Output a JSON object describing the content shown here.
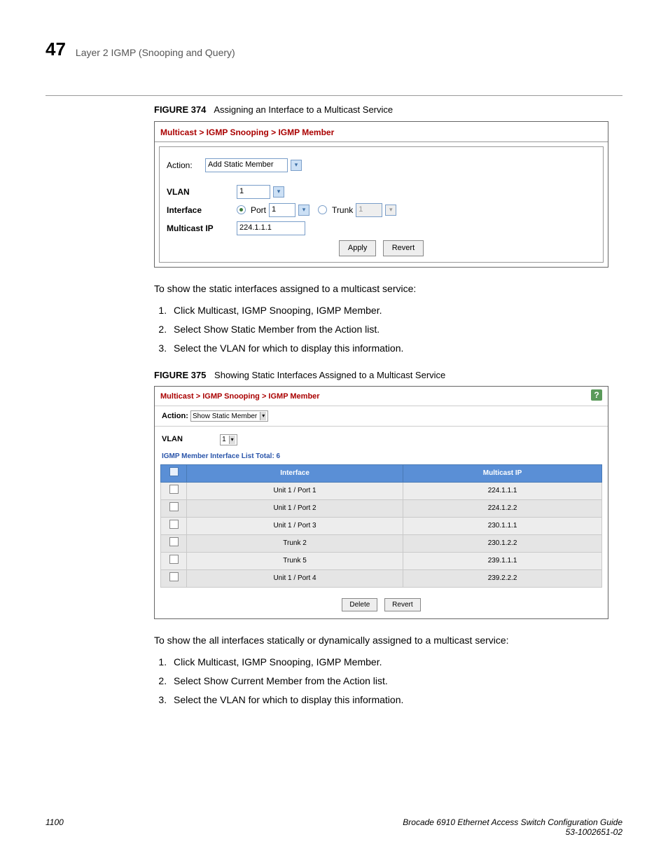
{
  "header": {
    "chapter_number": "47",
    "chapter_title": "Layer 2 IGMP (Snooping and Query)"
  },
  "fig374": {
    "num": "FIGURE 374",
    "caption": "Assigning an Interface to a Multicast Service",
    "breadcrumb": "Multicast > IGMP Snooping > IGMP Member",
    "action_label": "Action:",
    "action_value": "Add Static Member",
    "vlan_label": "VLAN",
    "vlan_value": "1",
    "iface_label": "Interface",
    "port_label": "Port",
    "port_value": "1",
    "trunk_label": "Trunk",
    "trunk_value": "1",
    "mcast_label": "Multicast IP",
    "mcast_value": "224.1.1.1",
    "apply": "Apply",
    "revert": "Revert"
  },
  "section1": {
    "intro": "To show the static interfaces assigned to a multicast service:",
    "steps": [
      "Click Multicast, IGMP Snooping, IGMP Member.",
      "Select Show Static Member from the Action list.",
      "Select the VLAN for which to display this information."
    ]
  },
  "fig375": {
    "num": "FIGURE 375",
    "caption": "Showing Static Interfaces Assigned to a Multicast Service",
    "breadcrumb": "Multicast > IGMP Snooping > IGMP Member",
    "action_label": "Action:",
    "action_value": "Show Static Member",
    "vlan_label": "VLAN",
    "vlan_value": "1",
    "list_label": "IGMP Member Interface List   Total: 6",
    "cols": {
      "iface": "Interface",
      "ip": "Multicast IP"
    },
    "rows": [
      {
        "iface": "Unit 1 / Port 1",
        "ip": "224.1.1.1"
      },
      {
        "iface": "Unit 1 / Port 2",
        "ip": "224.1.2.2"
      },
      {
        "iface": "Unit 1 / Port 3",
        "ip": "230.1.1.1"
      },
      {
        "iface": "Trunk 2",
        "ip": "230.1.2.2"
      },
      {
        "iface": "Trunk 5",
        "ip": "239.1.1.1"
      },
      {
        "iface": "Unit 1 / Port 4",
        "ip": "239.2.2.2"
      }
    ],
    "delete": "Delete",
    "revert": "Revert"
  },
  "section2": {
    "intro": "To show the all interfaces statically or dynamically assigned to a multicast service:",
    "steps": [
      "Click Multicast, IGMP Snooping, IGMP Member.",
      "Select Show Current Member from the Action list.",
      "Select the VLAN for which to display this information."
    ]
  },
  "footer": {
    "page": "1100",
    "title": "Brocade 6910 Ethernet Access Switch Configuration Guide",
    "doc": "53-1002651-02"
  }
}
